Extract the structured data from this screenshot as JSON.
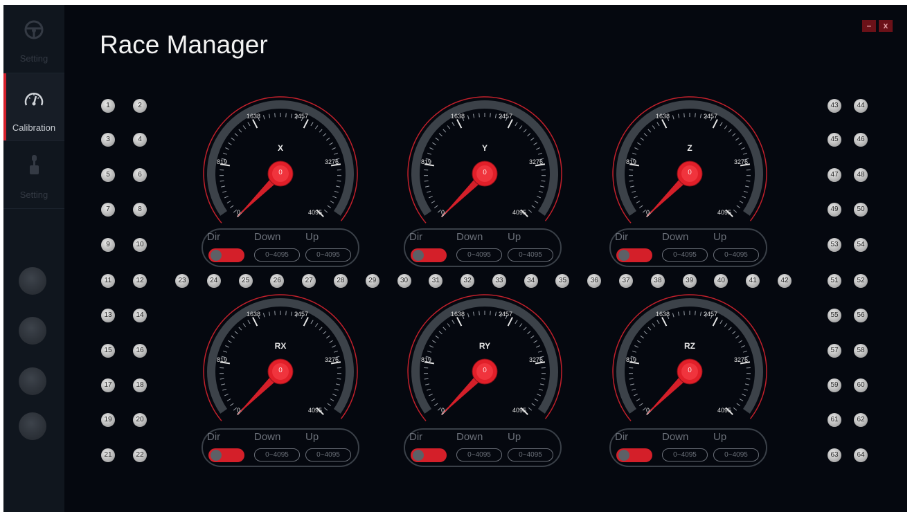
{
  "app_title": "Race Manager",
  "window_controls": {
    "minimize": "–",
    "close": "x"
  },
  "nav": [
    {
      "label": "Setting",
      "icon": "steering-wheel-icon",
      "active": false
    },
    {
      "label": "Calibration",
      "icon": "speedometer-icon",
      "active": true
    },
    {
      "label": "Setting",
      "icon": "gear-shifter-icon",
      "active": false
    }
  ],
  "buttons_left": [
    "1",
    "2",
    "3",
    "4",
    "5",
    "6",
    "7",
    "8",
    "9",
    "10",
    "11",
    "12",
    "13",
    "14",
    "15",
    "16",
    "17",
    "18",
    "19",
    "20",
    "21",
    "22"
  ],
  "buttons_middle": [
    "23",
    "24",
    "25",
    "26",
    "27",
    "28",
    "29",
    "30",
    "31",
    "32",
    "33",
    "34",
    "35",
    "36",
    "37",
    "38",
    "39",
    "40",
    "41",
    "42"
  ],
  "buttons_right": [
    "43",
    "44",
    "45",
    "46",
    "47",
    "48",
    "49",
    "50",
    "53",
    "54",
    "51",
    "52",
    "55",
    "56",
    "57",
    "58",
    "59",
    "60",
    "61",
    "62",
    "63",
    "64"
  ],
  "gauges": [
    {
      "axis": "X",
      "value": "0",
      "ticks": [
        "0",
        "819",
        "1638",
        "2457",
        "3276",
        "4095"
      ],
      "dir_label": "Dir",
      "down_label": "Down",
      "up_label": "Up",
      "down_range": "0~4095",
      "up_range": "0~4095"
    },
    {
      "axis": "Y",
      "value": "0",
      "ticks": [
        "0",
        "819",
        "1638",
        "2457",
        "3276",
        "4095"
      ],
      "dir_label": "Dir",
      "down_label": "Down",
      "up_label": "Up",
      "down_range": "0~4095",
      "up_range": "0~4095"
    },
    {
      "axis": "Z",
      "value": "0",
      "ticks": [
        "0",
        "819",
        "1638",
        "2457",
        "3276",
        "4095"
      ],
      "dir_label": "Dir",
      "down_label": "Down",
      "up_label": "Up",
      "down_range": "0~4095",
      "up_range": "0~4095"
    },
    {
      "axis": "RX",
      "value": "0",
      "ticks": [
        "0",
        "819",
        "1638",
        "2457",
        "3276",
        "4095"
      ],
      "dir_label": "Dir",
      "down_label": "Down",
      "up_label": "Up",
      "down_range": "0~4095",
      "up_range": "0~4095"
    },
    {
      "axis": "RY",
      "value": "0",
      "ticks": [
        "0",
        "819",
        "1638",
        "2457",
        "3276",
        "4095"
      ],
      "dir_label": "Dir",
      "down_label": "Down",
      "up_label": "Up",
      "down_range": "0~4095",
      "up_range": "0~4095"
    },
    {
      "axis": "RZ",
      "value": "0",
      "ticks": [
        "0",
        "819",
        "1638",
        "2457",
        "3276",
        "4095"
      ],
      "dir_label": "Dir",
      "down_label": "Down",
      "up_label": "Up",
      "down_range": "0~4095",
      "up_range": "0~4095"
    }
  ],
  "colors": {
    "accent": "#d51f2a",
    "background": "#05080f",
    "sidebar": "#10161e",
    "gauge_track": "#3c4249"
  }
}
